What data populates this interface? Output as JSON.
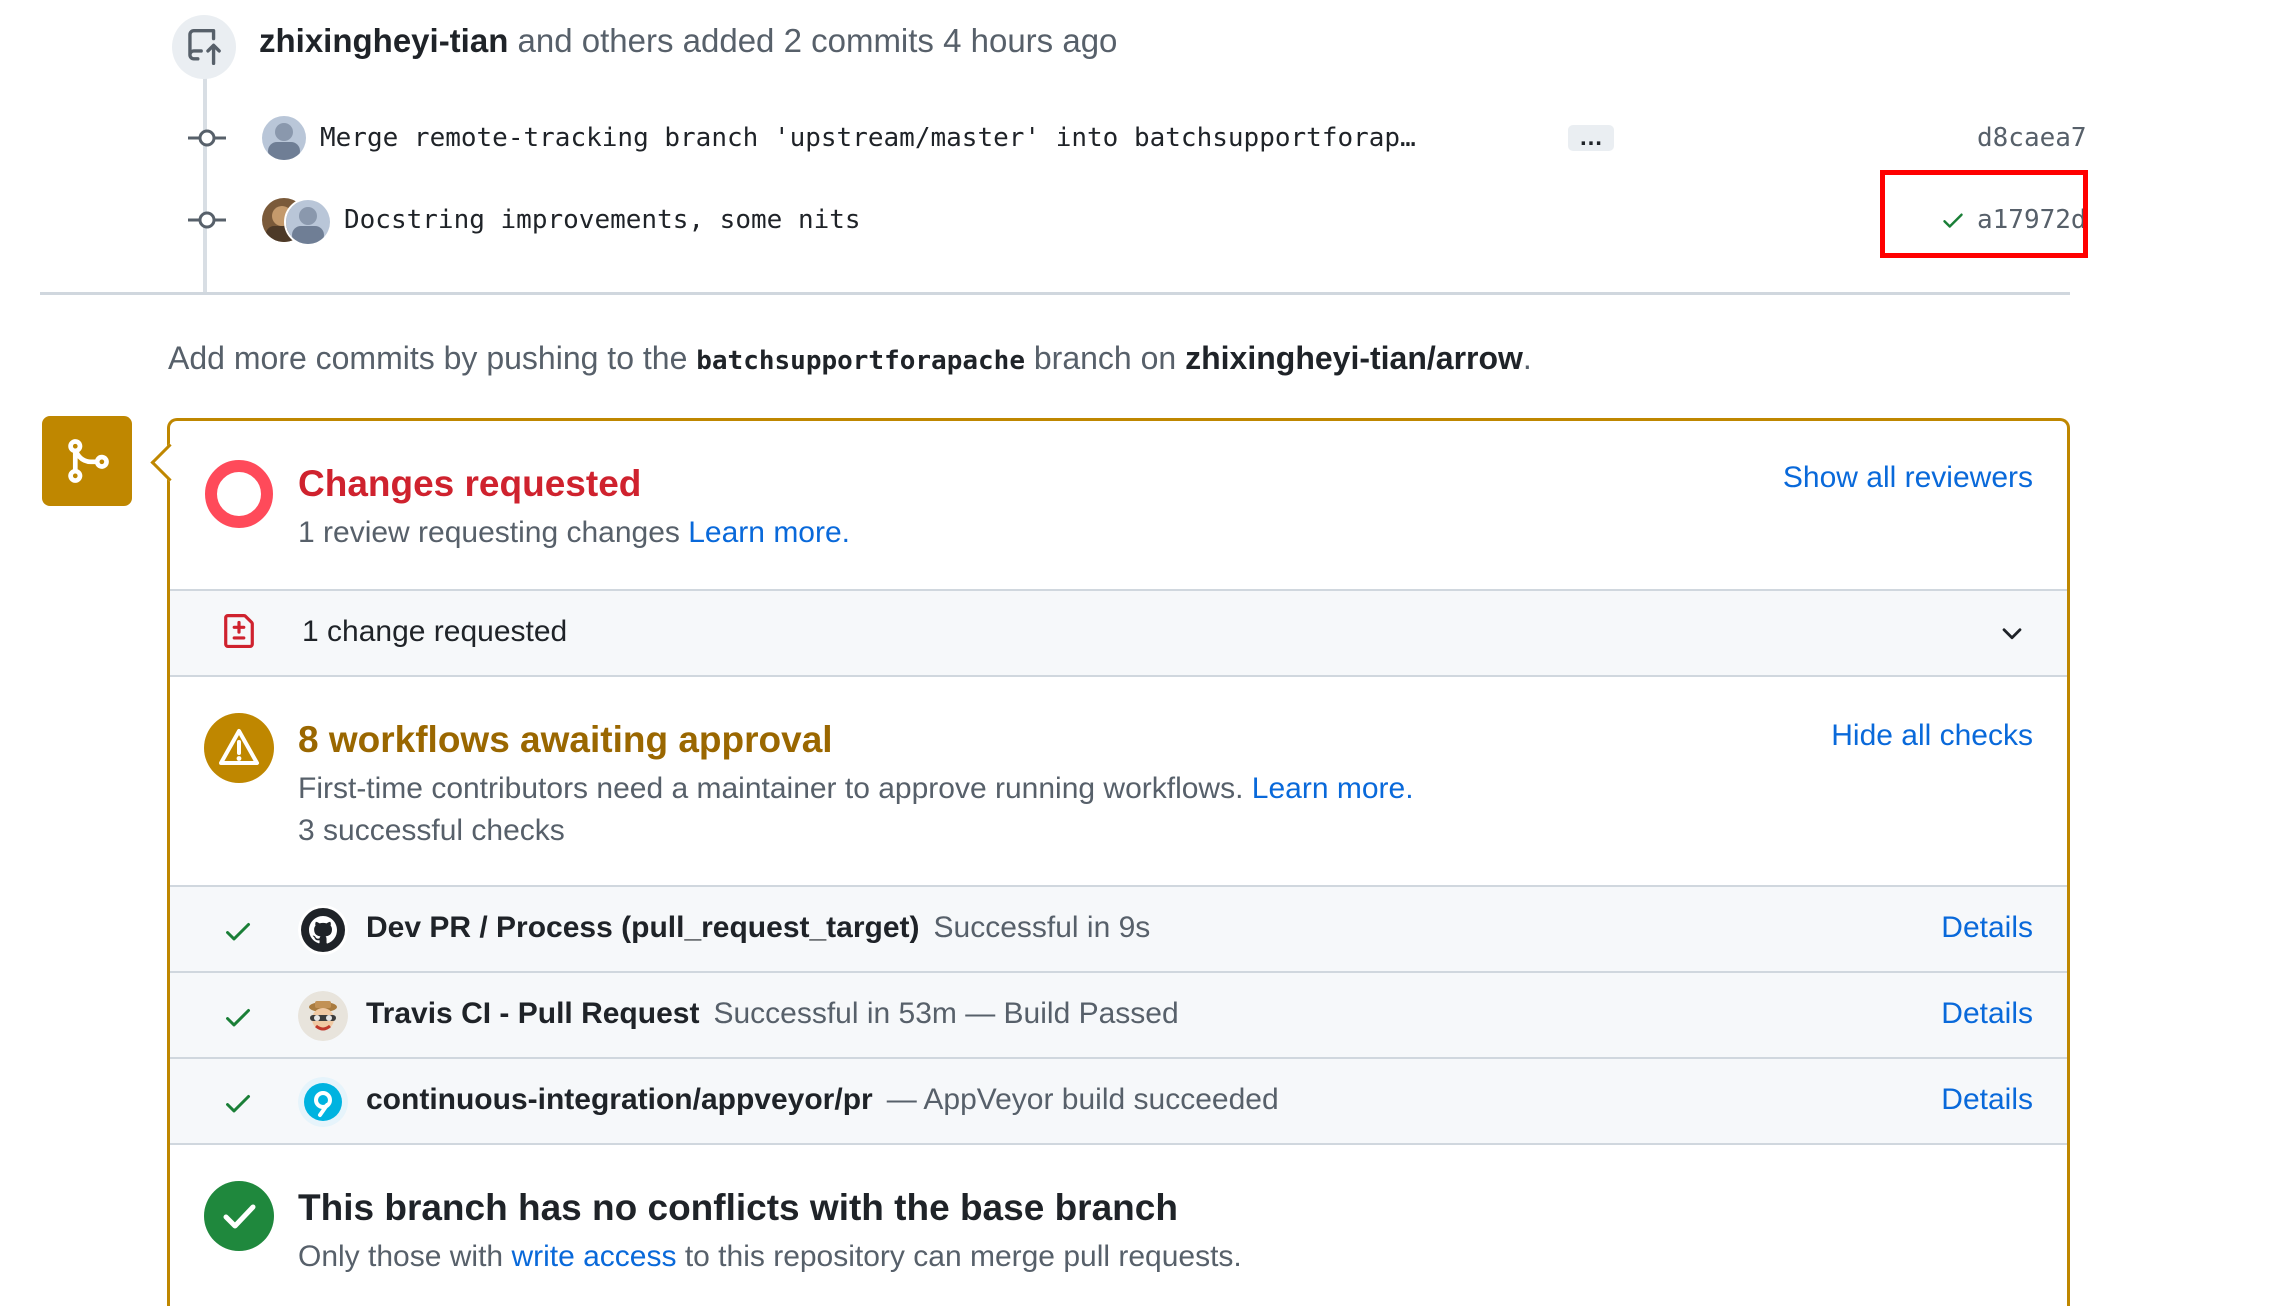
{
  "event": {
    "author": "zhixingheyi-tian",
    "text": "and others added 2 commits 4 hours ago"
  },
  "commits": [
    {
      "message": "Merge remote-tracking branch 'upstream/master' into batchsupportforap…",
      "more": "…",
      "sha": "d8caea7"
    },
    {
      "message": "Docstring improvements, some nits",
      "sha": "a17972d"
    }
  ],
  "push_note": {
    "prefix": "Add more commits by pushing to the",
    "branch": "batchsupportforapache",
    "middle": "branch on",
    "repo": "zhixingheyi-tian/arrow",
    "suffix": "."
  },
  "review": {
    "title": "Changes requested",
    "subtitle": "1 review requesting changes",
    "learn_more": "Learn more.",
    "show_reviewers": "Show all reviewers",
    "change_count_label": "1 change requested"
  },
  "workflows": {
    "title": "8 workflows awaiting approval",
    "subtitle": "First-time contributors need a maintainer to approve running workflows.",
    "learn_more": "Learn more.",
    "successful": "3 successful checks",
    "hide_checks": "Hide all checks"
  },
  "checks": [
    {
      "name": "Dev PR / Process (pull_request_target)",
      "desc": "Successful in 9s",
      "details": "Details"
    },
    {
      "name": "Travis CI - Pull Request",
      "desc": "Successful in 53m — Build Passed",
      "details": "Details"
    },
    {
      "name": "continuous-integration/appveyor/pr",
      "desc": "— AppVeyor build succeeded",
      "details": "Details"
    }
  ],
  "conflicts": {
    "title": "This branch has no conflicts with the base branch",
    "prefix": "Only those with",
    "link": "write access",
    "suffix": "to this repository can merge pull requests."
  },
  "colors": {
    "danger": "#cf222e",
    "attention": "#9a6700",
    "success": "#1a7f37",
    "link": "#0969da",
    "highlight": "#ff0000"
  }
}
